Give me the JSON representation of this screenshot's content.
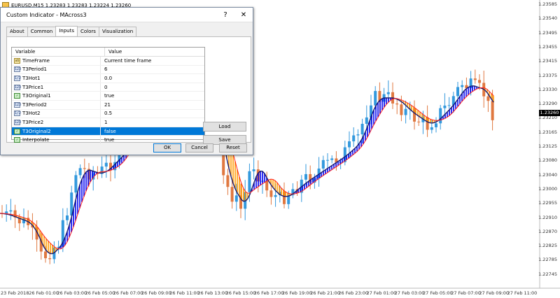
{
  "chart": {
    "title": "EURUSD,M15  1.23283 1.23283 1.23224 1.23260",
    "current_price": "1.23260",
    "price_labels": [
      "1.23585",
      "1.23540",
      "1.23495",
      "1.23455",
      "1.23415",
      "1.23375",
      "1.23330",
      "1.23290",
      "1.23210",
      "1.23165",
      "1.23125",
      "1.23080",
      "1.23040",
      "1.23000",
      "1.22955",
      "1.22910",
      "1.22870",
      "1.22825",
      "1.22785",
      "1.22745"
    ],
    "time_labels": [
      "23 Feb 2018",
      "26 Feb 01:00",
      "26 Feb 03:00",
      "26 Feb 05:00",
      "26 Feb 07:00",
      "26 Feb 09:00",
      "26 Feb 11:00",
      "26 Feb 13:00",
      "26 Feb 15:00",
      "26 Feb 17:00",
      "26 Feb 19:00",
      "26 Feb 21:00",
      "26 Feb 23:00",
      "27 Feb 01:00",
      "27 Feb 03:00",
      "27 Feb 05:00",
      "27 Feb 07:00",
      "27 Feb 09:00",
      "27 Feb 11:00"
    ],
    "colors": {
      "bull": "#3399dd",
      "bear": "#e07840",
      "fill_up": "#0000ee",
      "fill_down": "#ff9900",
      "line_a": "#1a1a6e",
      "line_b": "#ff2020"
    }
  },
  "dialog": {
    "title": "Custom Indicator - MAcross3",
    "help_glyph": "?",
    "close_glyph": "✕",
    "tabs": [
      "About",
      "Common",
      "Inputs",
      "Colors",
      "Visualization"
    ],
    "active_tab": 2,
    "grid": {
      "header_variable": "Variable",
      "header_value": "Value",
      "rows": [
        {
          "icon": "ab",
          "icon_text": "ab",
          "name": "TimeFrame",
          "value": "Current time frame"
        },
        {
          "icon": "num",
          "icon_text": "123",
          "name": "T3Period1",
          "value": "6"
        },
        {
          "icon": "num",
          "icon_text": "1/2",
          "name": "T3Hot1",
          "value": "0.0"
        },
        {
          "icon": "num",
          "icon_text": "123",
          "name": "T3Price1",
          "value": "0"
        },
        {
          "icon": "bool",
          "icon_text": "✓",
          "name": "T3Original1",
          "value": "true"
        },
        {
          "icon": "num",
          "icon_text": "123",
          "name": "T3Period2",
          "value": "21"
        },
        {
          "icon": "num",
          "icon_text": "1/2",
          "name": "T3Hot2",
          "value": "0.5"
        },
        {
          "icon": "num",
          "icon_text": "123",
          "name": "T3Price2",
          "value": "1"
        },
        {
          "icon": "bool",
          "icon_text": "✓",
          "name": "T3Original2",
          "value": "false"
        },
        {
          "icon": "bool",
          "icon_text": "✓",
          "name": "Interpolate",
          "value": "true"
        }
      ],
      "selected_row": 8
    },
    "load_label": "Load",
    "save_label": "Save",
    "ok_label": "OK",
    "cancel_label": "Cancel",
    "reset_label": "Reset"
  }
}
